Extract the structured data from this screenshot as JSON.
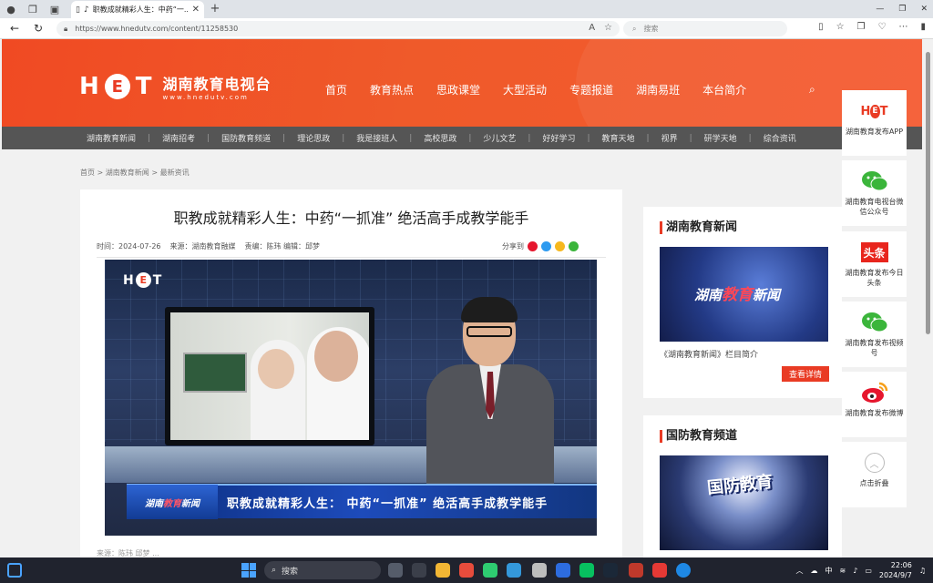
{
  "browser": {
    "tab_title": "职教成就精彩人生：中药“一...",
    "url": "https://www.hnedutv.com/content/11258530",
    "search_placeholder": "搜索"
  },
  "site": {
    "logo_letters": [
      "H",
      "E",
      "T"
    ],
    "logo_name": "湖南教育电视台",
    "logo_url": "www.hnedutv.com",
    "main_nav": [
      "首页",
      "教育热点",
      "思政课堂",
      "大型活动",
      "专题报道",
      "湖南易班",
      "本台简介"
    ],
    "sub_nav": [
      "湖南教育新闻",
      "湖南招考",
      "国防教育频道",
      "理论思政",
      "我是接班人",
      "高校思政",
      "少儿文艺",
      "好好学习",
      "教育天地",
      "视界",
      "研学天地",
      "综合资讯"
    ]
  },
  "breadcrumb": "首页 > 湖南教育新闻 > 最新资讯",
  "article": {
    "title": "职教成就精彩人生：中药“一抓准” 绝活高手成教学能手",
    "time_label": "时间：",
    "time": "2024-07-26",
    "source_label": "来源：",
    "source": "湖南教育融媒",
    "editor": "责编：陈玮 编辑：邱梦",
    "share_label": "分享到",
    "video_tag_a": "湖南",
    "video_tag_b": "教育",
    "video_tag_c": "新闻",
    "video_caption": "职教成就精彩人生： 中药“一抓准” 绝活高手成教学能手",
    "credit": "来源：陈玮 邱梦 ..."
  },
  "sidebar": {
    "box1_title": "湖南教育新闻",
    "box1_image_a": "湖南",
    "box1_image_b": "教育",
    "box1_image_c": "新闻",
    "box1_caption": "《湖南教育新闻》栏目简介",
    "box1_button": "查看详情",
    "box2_title": "国防教育频道",
    "box2_image_text": "国防教育"
  },
  "social": [
    {
      "label": "湖南教育发布APP",
      "icon": "het-app-icon"
    },
    {
      "label": "湖南教育电视台微信公众号",
      "icon": "wechat-icon"
    },
    {
      "label": "湖南教育发布今日头条",
      "icon": "toutiao-icon"
    },
    {
      "label": "湖南教育发布视频号",
      "icon": "wechat-video-icon"
    },
    {
      "label": "湖南教育发布微博",
      "icon": "weibo-icon"
    },
    {
      "label": "点击折叠",
      "icon": "collapse-icon"
    }
  ],
  "taskbar": {
    "search": "搜索",
    "ime": "中",
    "time": "22:06",
    "date": "2024/9/7"
  },
  "colors": {
    "brand": "#e93b24",
    "subnav": "#555555"
  }
}
